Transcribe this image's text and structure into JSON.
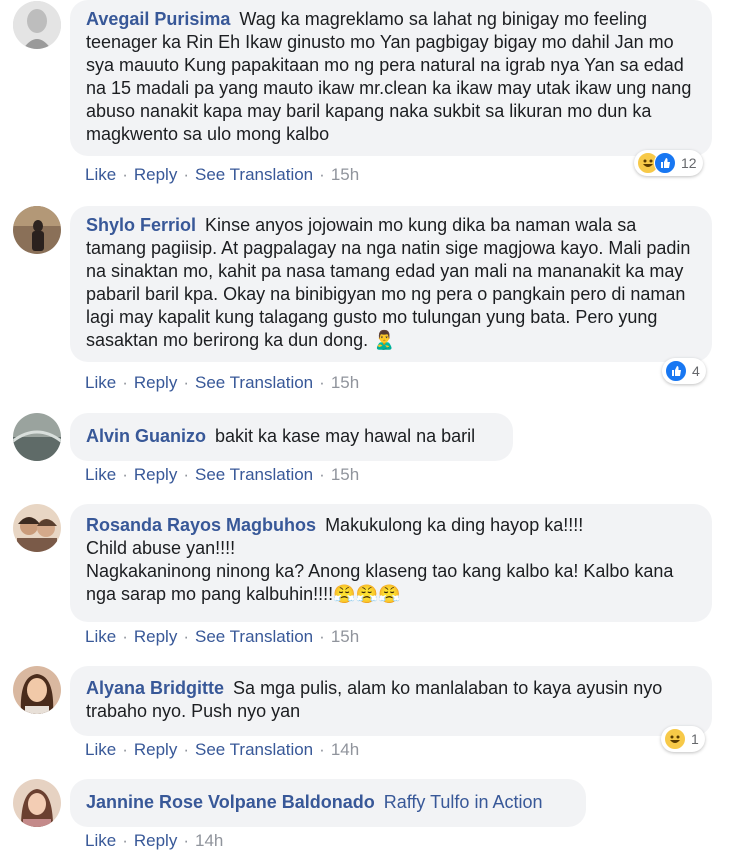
{
  "comments": [
    {
      "author": "Avegail Purisima",
      "text": "Wag ka magreklamo sa lahat ng binigay mo feeling teenager ka Rin Eh Ikaw ginusto mo Yan pagbigay bigay mo dahil Jan mo sya mauuto Kung papakitaan mo ng pera natural na igrab nya Yan sa edad na 15 madali pa yang mauto ikaw mr.clean ka ikaw may utak ikaw ung nang abuso nanakit kapa may baril kapang naka sukbit sa likuran mo dun ka magkwento sa ulo mong kalbo",
      "like": "Like",
      "reply": "Reply",
      "translate": "See Translation",
      "time": "15h",
      "reaction_count": "12",
      "reaction_icons": [
        "haha-icon",
        "like-icon"
      ]
    },
    {
      "author": "Shylo Ferriol",
      "text": "Kinse anyos jojowain mo kung dika ba naman wala sa tamang pagiisip. At pagpalagay na nga natin sige magjowa kayo. Mali padin na sinaktan mo, kahit pa nasa tamang edad yan mali na mananakit ka may pabaril baril kpa. Okay na binibigyan mo ng pera o pangkain pero di naman lagi may kapalit kung talagang gusto mo tulungan yung bata. Pero yung sasaktan mo berirong ka dun dong.",
      "like": "Like",
      "reply": "Reply",
      "translate": "See Translation",
      "time": "15h",
      "reaction_count": "4",
      "reaction_icons": [
        "like-icon"
      ]
    },
    {
      "author": "Alvin Guanizo",
      "text": "bakit ka kase may hawal na baril",
      "like": "Like",
      "reply": "Reply",
      "translate": "See Translation",
      "time": "15h"
    },
    {
      "author": "Rosanda Rayos Magbuhos",
      "text_line1": "Makukulong ka ding hayop ka!!!!",
      "text_line2": "Child abuse yan!!!!",
      "text_line3": "Nagkakaninong ninong ka? Anong klaseng tao kang kalbo ka! Kalbo kana nga sarap mo pang kalbuhin!!!!",
      "emojis": "😤😤😤",
      "like": "Like",
      "reply": "Reply",
      "translate": "See Translation",
      "time": "15h"
    },
    {
      "author": "Alyana Bridgitte",
      "text": "Sa mga pulis, alam ko manlalaban to kaya ayusin nyo trabaho nyo. Push nyo yan",
      "like": "Like",
      "reply": "Reply",
      "translate": "See Translation",
      "time": "14h",
      "reaction_count": "1",
      "reaction_icons": [
        "haha-icon"
      ]
    },
    {
      "author": "Jannine Rose Volpane Baldonado",
      "text": "Raffy Tulfo in Action",
      "like": "Like",
      "reply": "Reply",
      "time": "14h"
    }
  ],
  "colors": {
    "author": "#385898",
    "bubble": "#f2f3f5",
    "meta": "#90949c",
    "like_blue": "#1877f2",
    "haha_yellow": "#f7c948"
  }
}
